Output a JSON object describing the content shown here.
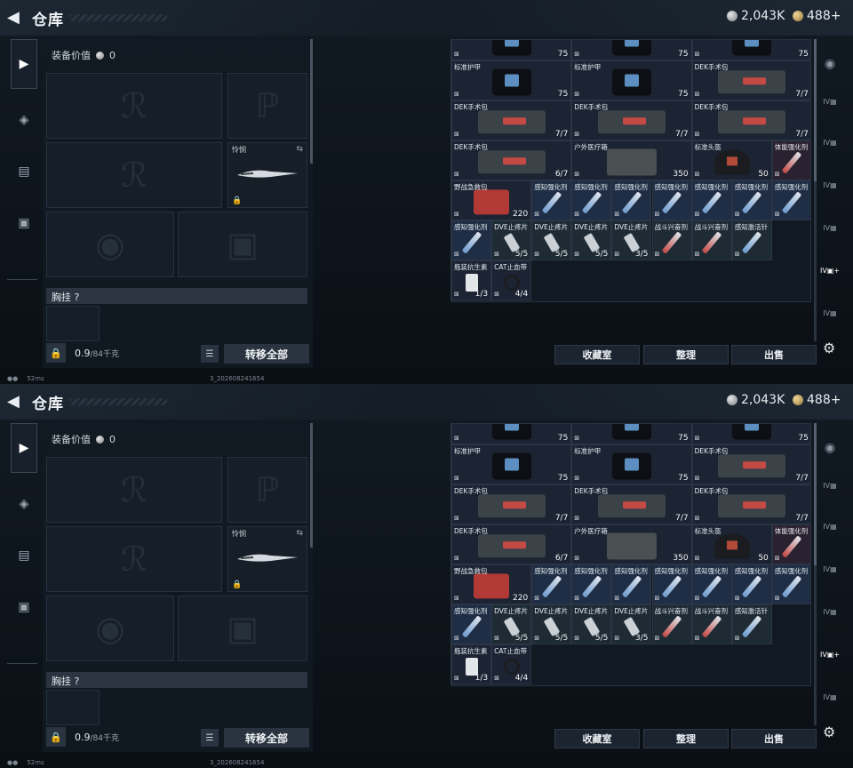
{
  "header": {
    "title": "仓库",
    "silver": "2,043K",
    "gold": "488+"
  },
  "left": {
    "equip_value_label": "装备价值",
    "equip_value": "0",
    "melee_label": "怜悯",
    "chest_label": "胸挂",
    "chest_help": "?",
    "weight": "0.9",
    "weight_max": "/84千克",
    "transfer_all": "转移全部"
  },
  "status": {
    "ping": "52ms",
    "build": "3_202608241654"
  },
  "buttons": {
    "favorites": "收藏室",
    "sort": "整理",
    "sell": "出售"
  },
  "grid_rows": [
    [
      {
        "name": "",
        "val": "75",
        "type": "armor"
      },
      {
        "name": "",
        "val": "75",
        "type": "armor"
      },
      {
        "name": "",
        "val": "75",
        "type": "armor"
      }
    ],
    [
      {
        "name": "标准护甲",
        "val": "75",
        "type": "armor"
      },
      {
        "name": "标准护甲",
        "val": "75",
        "type": "armor"
      },
      {
        "name": "DEK手术包",
        "val": "7/7",
        "type": "medkit"
      }
    ],
    [
      {
        "name": "DEK手术包",
        "val": "7/7",
        "type": "medkit"
      },
      {
        "name": "DEK手术包",
        "val": "7/7",
        "type": "medkit"
      },
      {
        "name": "DEK手术包",
        "val": "7/7",
        "type": "medkit"
      }
    ],
    [
      {
        "name": "DEK手术包",
        "val": "6/7",
        "type": "medkit"
      },
      {
        "name": "户外医疗箱",
        "val": "350",
        "type": "bag"
      },
      {
        "name": "标准头盔",
        "val": "50",
        "type": "helm"
      },
      {
        "name": "体能强化剂",
        "val": "",
        "type": "syr-red"
      }
    ],
    [
      {
        "name": "野战急救包",
        "val": "220",
        "type": "redkit"
      },
      {
        "name": "感知强化剂",
        "val": "",
        "type": "syr"
      },
      {
        "name": "感知强化剂",
        "val": "",
        "type": "syr"
      },
      {
        "name": "感知强化剂",
        "val": "",
        "type": "syr"
      },
      {
        "name": "感知强化剂",
        "val": "",
        "type": "syr"
      },
      {
        "name": "感知强化剂",
        "val": "",
        "type": "syr"
      },
      {
        "name": "感知强化剂",
        "val": "",
        "type": "syr"
      },
      {
        "name": "感知强化剂",
        "val": "",
        "type": "syr"
      }
    ],
    [
      {
        "name": "感知强化剂",
        "val": "",
        "type": "syr"
      },
      {
        "name": "DVE止疼片",
        "val": "5/5",
        "type": "canister"
      },
      {
        "name": "DVE止疼片",
        "val": "5/5",
        "type": "canister"
      },
      {
        "name": "DVE止疼片",
        "val": "5/5",
        "type": "canister"
      },
      {
        "name": "DVE止疼片",
        "val": "3/5",
        "type": "canister"
      },
      {
        "name": "战斗兴奋剂",
        "val": "",
        "type": "syr-red"
      },
      {
        "name": "战斗兴奋剂",
        "val": "",
        "type": "syr-red"
      },
      {
        "name": "感知激活针",
        "val": "",
        "type": "syr"
      }
    ],
    [
      {
        "name": "瓶装抗生素",
        "val": "1/3",
        "type": "can"
      },
      {
        "name": "CAT止血带",
        "val": "4/4",
        "type": "tourniquet"
      }
    ]
  ],
  "icons": {
    "back": "back-arrow-icon",
    "lock": "lock-icon",
    "list": "list-icon",
    "gear": "gear-icon"
  }
}
